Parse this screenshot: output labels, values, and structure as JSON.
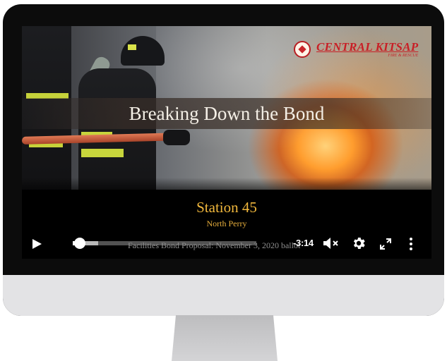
{
  "video": {
    "title": "Breaking Down the Bond",
    "station": "Station 45",
    "area": "North Perry",
    "caption": "Facilities Bond Proposal: November 3, 2020 ballot",
    "logo": {
      "main": "CENTRAL KITSAP",
      "sub": "FIRE & RESCUE",
      "color": "#c81f26"
    },
    "accent_gold": "#f0b73c"
  },
  "player": {
    "time_remaining": "-3:14",
    "progress": 0.04,
    "buffered": 0.14,
    "icons": [
      "play-icon",
      "volume-muted-icon",
      "settings-gear-icon",
      "fullscreen-icon",
      "more-options-icon"
    ]
  }
}
